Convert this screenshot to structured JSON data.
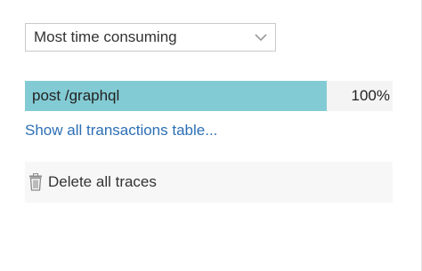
{
  "sort_select": {
    "selected": "Most time consuming",
    "icon": "chevron-down-icon"
  },
  "transactions": [
    {
      "name": "post /graphql",
      "percent_label": "100%",
      "share": 0.82,
      "bar_color": "#83cbd4"
    }
  ],
  "show_all_link": "Show all transactions table...",
  "delete_button": {
    "label": "Delete all traces",
    "icon": "trash-icon"
  },
  "colors": {
    "link": "#2c6fb5",
    "bar": "#83cbd4"
  }
}
